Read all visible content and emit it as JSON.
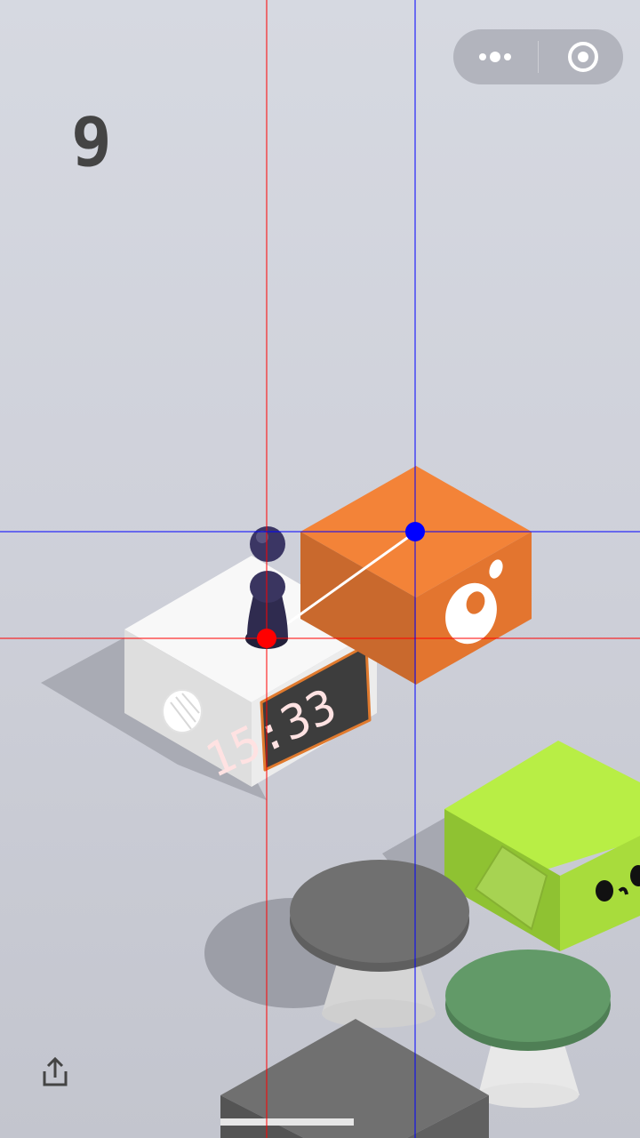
{
  "score": "9",
  "clock_time": "15:33",
  "colors": {
    "guide_red": "#ff0000",
    "guide_blue": "#0000ff",
    "orange_box": "#f0813a",
    "lime_box": "#b5e843",
    "white_box": "#f6f6f6",
    "grey_stool": "#6f6f6f",
    "green_stool": "#629a68",
    "player": "#2f2b4f"
  },
  "icons": {
    "more": "more-dots-icon",
    "close": "target-circle-icon",
    "share": "share-icon"
  }
}
